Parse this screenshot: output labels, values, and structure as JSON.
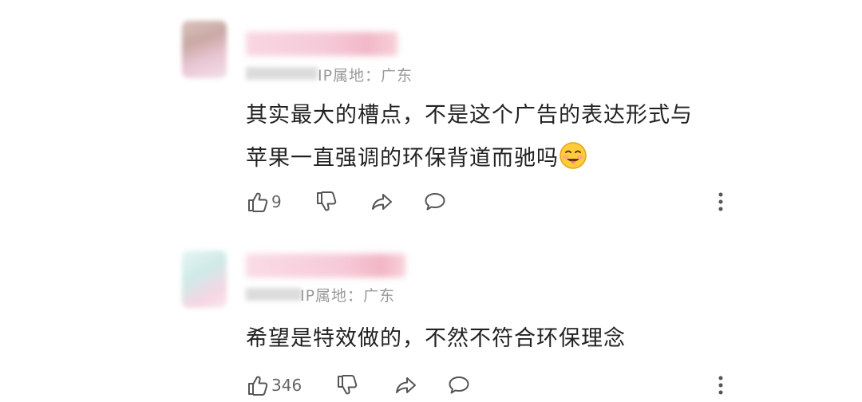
{
  "comments": [
    {
      "ip_label": "IP属地：广东",
      "text_lines": [
        "其实最大的槽点，不是这个广告的表达形式与",
        "苹果一直强调的环保背道而驰吗"
      ],
      "emoji": "grinning-face-with-tongue",
      "likes": "9"
    },
    {
      "ip_label": "IP属地：广东",
      "text_lines": [
        "希望是特效做的，不然不符合环保理念"
      ],
      "likes": "346"
    }
  ],
  "icons": {
    "like": "thumbs-up-icon",
    "dislike": "thumbs-down-icon",
    "share": "share-icon",
    "reply": "comment-icon",
    "more": "more-vertical-icon"
  },
  "colors": {
    "text": "#222222",
    "meta": "#999999",
    "icon": "#555555"
  }
}
